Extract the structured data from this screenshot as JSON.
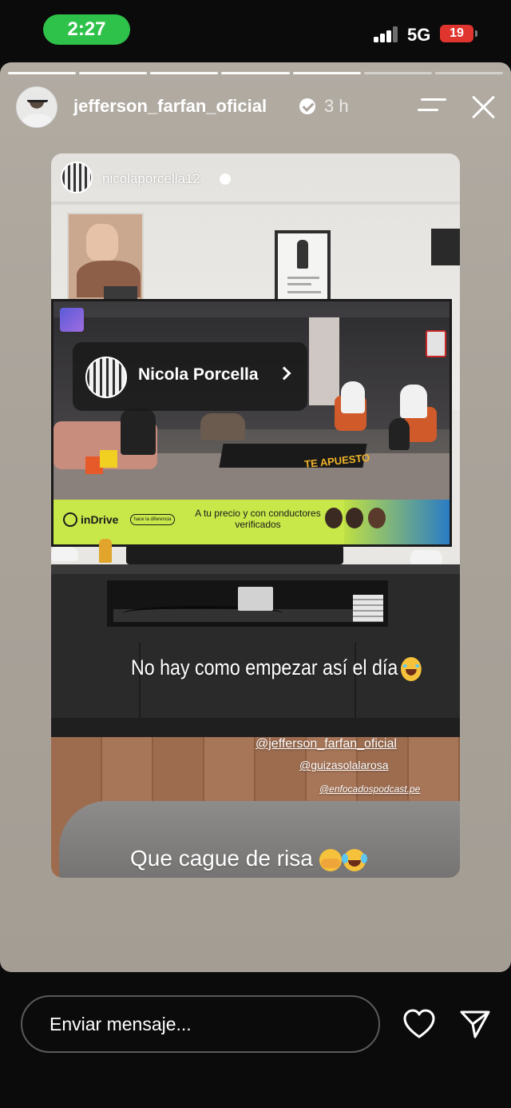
{
  "status_bar": {
    "time": "2:27",
    "network": "5G",
    "battery": "19",
    "battery_color": "#e0352f",
    "time_pill_color": "#2fc24a"
  },
  "story": {
    "progress": {
      "segments": 7,
      "current": 5
    },
    "header": {
      "username": "jefferson_farfan_oficial",
      "verified": true,
      "time_ago": "3 h",
      "icons": [
        "menu-icon",
        "close-icon"
      ]
    },
    "shared_post": {
      "username": "nicolaporcella12",
      "verified": true,
      "profile_link": {
        "name": "Nicola Porcella"
      },
      "tv_screen": {
        "brand": "TE APUESTO",
        "ad": {
          "brand": "inDrive",
          "tag": "hace la diferencia",
          "text": "A tu precio y con conductores verificados"
        }
      },
      "caption": "No hay como empezar así el día",
      "caption_emoji": "face-with-tears-of-joy",
      "mentions": [
        "@jefferson_farfan_oficial",
        "@guizasolalarosa",
        "@enfocadospodcast.pe"
      ]
    },
    "text": "Que cague de risa",
    "text_emojis": [
      "face-with-hand-over-mouth",
      "loudly-crying-face"
    ]
  },
  "reply_bar": {
    "placeholder": "Enviar mensaje...",
    "icons": [
      "heart-icon",
      "send-icon"
    ]
  }
}
